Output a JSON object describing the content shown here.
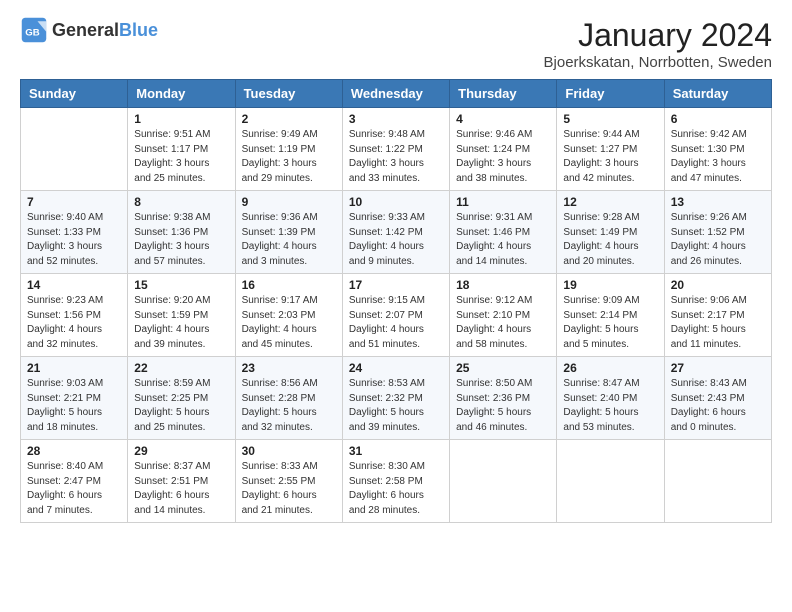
{
  "header": {
    "logo_general": "General",
    "logo_blue": "Blue",
    "month_year": "January 2024",
    "location": "Bjoerkskatan, Norrbotten, Sweden"
  },
  "weekdays": [
    "Sunday",
    "Monday",
    "Tuesday",
    "Wednesday",
    "Thursday",
    "Friday",
    "Saturday"
  ],
  "weeks": [
    [
      {
        "day": "",
        "info": ""
      },
      {
        "day": "1",
        "info": "Sunrise: 9:51 AM\nSunset: 1:17 PM\nDaylight: 3 hours\nand 25 minutes."
      },
      {
        "day": "2",
        "info": "Sunrise: 9:49 AM\nSunset: 1:19 PM\nDaylight: 3 hours\nand 29 minutes."
      },
      {
        "day": "3",
        "info": "Sunrise: 9:48 AM\nSunset: 1:22 PM\nDaylight: 3 hours\nand 33 minutes."
      },
      {
        "day": "4",
        "info": "Sunrise: 9:46 AM\nSunset: 1:24 PM\nDaylight: 3 hours\nand 38 minutes."
      },
      {
        "day": "5",
        "info": "Sunrise: 9:44 AM\nSunset: 1:27 PM\nDaylight: 3 hours\nand 42 minutes."
      },
      {
        "day": "6",
        "info": "Sunrise: 9:42 AM\nSunset: 1:30 PM\nDaylight: 3 hours\nand 47 minutes."
      }
    ],
    [
      {
        "day": "7",
        "info": "Sunrise: 9:40 AM\nSunset: 1:33 PM\nDaylight: 3 hours\nand 52 minutes."
      },
      {
        "day": "8",
        "info": "Sunrise: 9:38 AM\nSunset: 1:36 PM\nDaylight: 3 hours\nand 57 minutes."
      },
      {
        "day": "9",
        "info": "Sunrise: 9:36 AM\nSunset: 1:39 PM\nDaylight: 4 hours\nand 3 minutes."
      },
      {
        "day": "10",
        "info": "Sunrise: 9:33 AM\nSunset: 1:42 PM\nDaylight: 4 hours\nand 9 minutes."
      },
      {
        "day": "11",
        "info": "Sunrise: 9:31 AM\nSunset: 1:46 PM\nDaylight: 4 hours\nand 14 minutes."
      },
      {
        "day": "12",
        "info": "Sunrise: 9:28 AM\nSunset: 1:49 PM\nDaylight: 4 hours\nand 20 minutes."
      },
      {
        "day": "13",
        "info": "Sunrise: 9:26 AM\nSunset: 1:52 PM\nDaylight: 4 hours\nand 26 minutes."
      }
    ],
    [
      {
        "day": "14",
        "info": "Sunrise: 9:23 AM\nSunset: 1:56 PM\nDaylight: 4 hours\nand 32 minutes."
      },
      {
        "day": "15",
        "info": "Sunrise: 9:20 AM\nSunset: 1:59 PM\nDaylight: 4 hours\nand 39 minutes."
      },
      {
        "day": "16",
        "info": "Sunrise: 9:17 AM\nSunset: 2:03 PM\nDaylight: 4 hours\nand 45 minutes."
      },
      {
        "day": "17",
        "info": "Sunrise: 9:15 AM\nSunset: 2:07 PM\nDaylight: 4 hours\nand 51 minutes."
      },
      {
        "day": "18",
        "info": "Sunrise: 9:12 AM\nSunset: 2:10 PM\nDaylight: 4 hours\nand 58 minutes."
      },
      {
        "day": "19",
        "info": "Sunrise: 9:09 AM\nSunset: 2:14 PM\nDaylight: 5 hours\nand 5 minutes."
      },
      {
        "day": "20",
        "info": "Sunrise: 9:06 AM\nSunset: 2:17 PM\nDaylight: 5 hours\nand 11 minutes."
      }
    ],
    [
      {
        "day": "21",
        "info": "Sunrise: 9:03 AM\nSunset: 2:21 PM\nDaylight: 5 hours\nand 18 minutes."
      },
      {
        "day": "22",
        "info": "Sunrise: 8:59 AM\nSunset: 2:25 PM\nDaylight: 5 hours\nand 25 minutes."
      },
      {
        "day": "23",
        "info": "Sunrise: 8:56 AM\nSunset: 2:28 PM\nDaylight: 5 hours\nand 32 minutes."
      },
      {
        "day": "24",
        "info": "Sunrise: 8:53 AM\nSunset: 2:32 PM\nDaylight: 5 hours\nand 39 minutes."
      },
      {
        "day": "25",
        "info": "Sunrise: 8:50 AM\nSunset: 2:36 PM\nDaylight: 5 hours\nand 46 minutes."
      },
      {
        "day": "26",
        "info": "Sunrise: 8:47 AM\nSunset: 2:40 PM\nDaylight: 5 hours\nand 53 minutes."
      },
      {
        "day": "27",
        "info": "Sunrise: 8:43 AM\nSunset: 2:43 PM\nDaylight: 6 hours\nand 0 minutes."
      }
    ],
    [
      {
        "day": "28",
        "info": "Sunrise: 8:40 AM\nSunset: 2:47 PM\nDaylight: 6 hours\nand 7 minutes."
      },
      {
        "day": "29",
        "info": "Sunrise: 8:37 AM\nSunset: 2:51 PM\nDaylight: 6 hours\nand 14 minutes."
      },
      {
        "day": "30",
        "info": "Sunrise: 8:33 AM\nSunset: 2:55 PM\nDaylight: 6 hours\nand 21 minutes."
      },
      {
        "day": "31",
        "info": "Sunrise: 8:30 AM\nSunset: 2:58 PM\nDaylight: 6 hours\nand 28 minutes."
      },
      {
        "day": "",
        "info": ""
      },
      {
        "day": "",
        "info": ""
      },
      {
        "day": "",
        "info": ""
      }
    ]
  ]
}
